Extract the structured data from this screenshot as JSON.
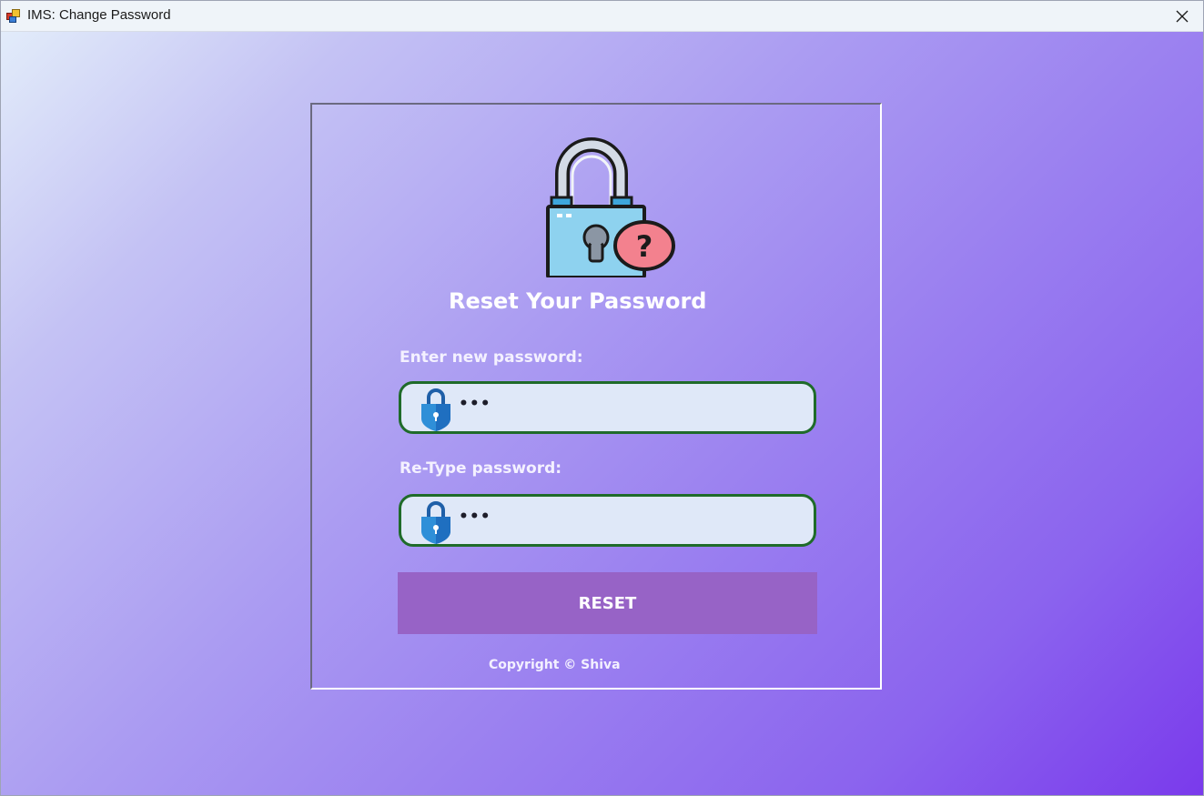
{
  "window": {
    "title": "IMS: Change Password",
    "app_icon": "forms-app-icon",
    "close_icon": "close-icon"
  },
  "form": {
    "heading": "Reset Your Password",
    "lock_graphic": "padlock-question-icon",
    "new_password": {
      "label": "Enter new password:",
      "value": "•••",
      "icon": "shield-lock-icon"
    },
    "retype_password": {
      "label": "Re-Type password:",
      "value": "•••",
      "icon": "shield-lock-icon"
    },
    "reset_label": "RESET",
    "copyright": "Copyright © Shiva"
  },
  "colors": {
    "field_border": "#1f6b2a",
    "field_bg": "#dfe8f8",
    "button_bg": "#9763c6",
    "gradient_start": "#e2ecfa",
    "gradient_end": "#7a3aec"
  }
}
